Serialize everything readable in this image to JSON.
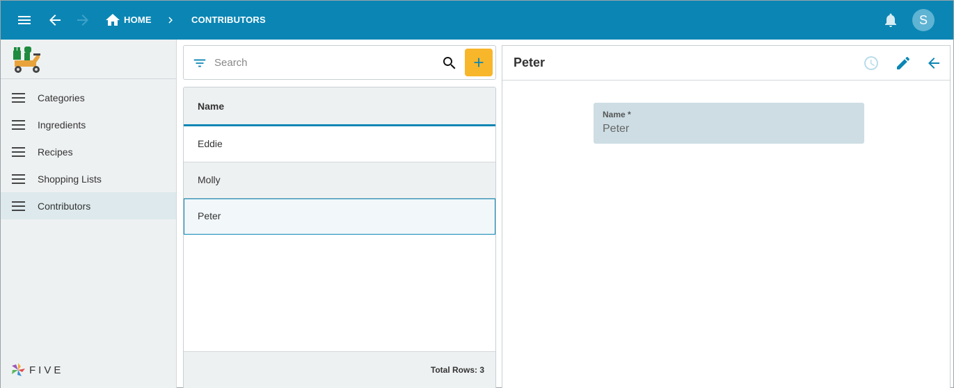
{
  "topbar": {
    "breadcrumb_home": "HOME",
    "breadcrumb_current": "CONTRIBUTORS",
    "avatar_initial": "S",
    "icons": [
      "menu-icon",
      "back-arrow-icon",
      "forward-arrow-icon",
      "home-icon",
      "chevron-right-icon",
      "bell-icon"
    ]
  },
  "sidebar": {
    "items": [
      {
        "label": "Categories",
        "icon": "menu-icon"
      },
      {
        "label": "Ingredients",
        "icon": "menu-icon"
      },
      {
        "label": "Recipes",
        "icon": "menu-icon"
      },
      {
        "label": "Shopping Lists",
        "icon": "menu-icon"
      },
      {
        "label": "Contributors",
        "icon": "menu-icon",
        "active": true
      }
    ],
    "brand": "FIVE"
  },
  "list": {
    "search_placeholder": "Search",
    "column_header": "Name",
    "rows": [
      "Eddie",
      "Molly",
      "Peter"
    ],
    "selected_row": "Peter",
    "total_rows_label": "Total Rows: 3"
  },
  "detail": {
    "title": "Peter",
    "field_label": "Name *",
    "field_value": "Peter",
    "icons": [
      "history-icon",
      "edit-icon",
      "back-arrow-icon"
    ]
  },
  "colors": {
    "primary": "#0b86b4",
    "accent": "#f8b62b",
    "sidebar_bg": "#eef1f2",
    "field_bg": "#cddde3"
  }
}
